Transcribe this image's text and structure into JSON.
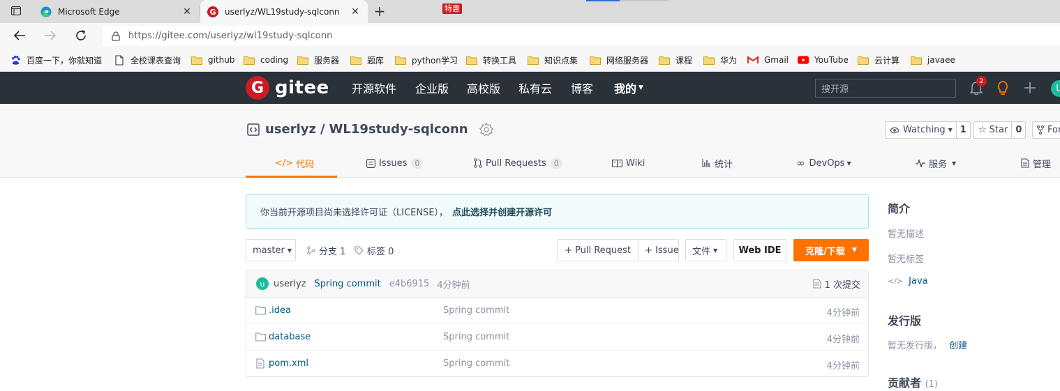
{
  "browser": {
    "tabs": [
      {
        "title": "Microsoft Edge"
      },
      {
        "title": "userlyz/WL19study-sqlconn"
      }
    ],
    "url": "https://gitee.com/userlyz/wl19study-sqlconn",
    "bookmarks": [
      {
        "label": "百度一下，你就知道",
        "icon": "baidu-icon"
      },
      {
        "label": "全校课表查询",
        "icon": "page-icon"
      },
      {
        "label": "github",
        "icon": "folder-icon"
      },
      {
        "label": "coding",
        "icon": "folder-icon"
      },
      {
        "label": "服务器",
        "icon": "folder-icon"
      },
      {
        "label": "题库",
        "icon": "folder-icon"
      },
      {
        "label": "python学习",
        "icon": "folder-icon"
      },
      {
        "label": "转换工具",
        "icon": "folder-icon"
      },
      {
        "label": "知识点集",
        "icon": "folder-icon"
      },
      {
        "label": "网络服务器",
        "icon": "folder-icon"
      },
      {
        "label": "课程",
        "icon": "folder-icon"
      },
      {
        "label": "华为",
        "icon": "folder-icon"
      },
      {
        "label": "Gmail",
        "icon": "gmail-icon"
      },
      {
        "label": "YouTube",
        "icon": "youtube-icon"
      },
      {
        "label": "云计算",
        "icon": "folder-icon"
      },
      {
        "label": "javaee",
        "icon": "folder-icon"
      }
    ]
  },
  "header": {
    "logo_text": "gitee",
    "nav": [
      "开源软件",
      "企业版",
      "高校版",
      "私有云",
      "博客",
      "我的"
    ],
    "enterprise_badge": "特惠",
    "search_placeholder": "搜开源",
    "notification_count": "2",
    "avatar_letter": "U",
    "colors": {
      "bg": "#2b3139",
      "brand": "#c71d23"
    }
  },
  "project": {
    "owner": "userlyz",
    "separator": "/",
    "name": "WL19study-sqlconn",
    "watching_label": "Watching",
    "watching_count": "1",
    "star_label": "Star",
    "star_count": "0",
    "fork_label": "For",
    "tabs": [
      {
        "label": "代码"
      },
      {
        "label": "Issues",
        "count": "0"
      },
      {
        "label": "Pull Requests",
        "count": "0"
      },
      {
        "label": "Wiki"
      },
      {
        "label": "统计"
      },
      {
        "label": "DevOps"
      },
      {
        "label": "服务"
      },
      {
        "label": "管理"
      }
    ],
    "accent": "#fe7300"
  },
  "notice": {
    "text": "你当前开源项目尚未选择许可证（LICENSE），",
    "link": "点此选择并创建开源许可"
  },
  "toolbar": {
    "branch": "master",
    "branches_label": "分支 1",
    "tags_label": "标签 0",
    "pull_request": "+ Pull Request",
    "issue": "+ Issue",
    "file_menu": "文件",
    "web_ide": "Web IDE",
    "clone": "克隆/下载"
  },
  "commit": {
    "avatar_letter": "u",
    "author": "userlyz",
    "message": "Spring commit",
    "hash": "e4b6915",
    "time": "4分钟前",
    "total": "1 次提交"
  },
  "files": [
    {
      "name": ".idea",
      "type": "folder",
      "message": "Spring commit",
      "time": "4分钟前"
    },
    {
      "name": "database",
      "type": "folder",
      "message": "Spring commit",
      "time": "4分钟前"
    },
    {
      "name": "pom.xml",
      "type": "file",
      "message": "Spring commit",
      "time": "4分钟前"
    }
  ],
  "sidebar": {
    "intro_title": "简介",
    "no_desc": "暂无描述",
    "no_tags": "暂无标签",
    "language": "Java",
    "release_title": "发行版",
    "no_release": "暂无发行版，",
    "create": "创建",
    "contributors_title": "贡献者",
    "contributors_count": "(1)"
  }
}
